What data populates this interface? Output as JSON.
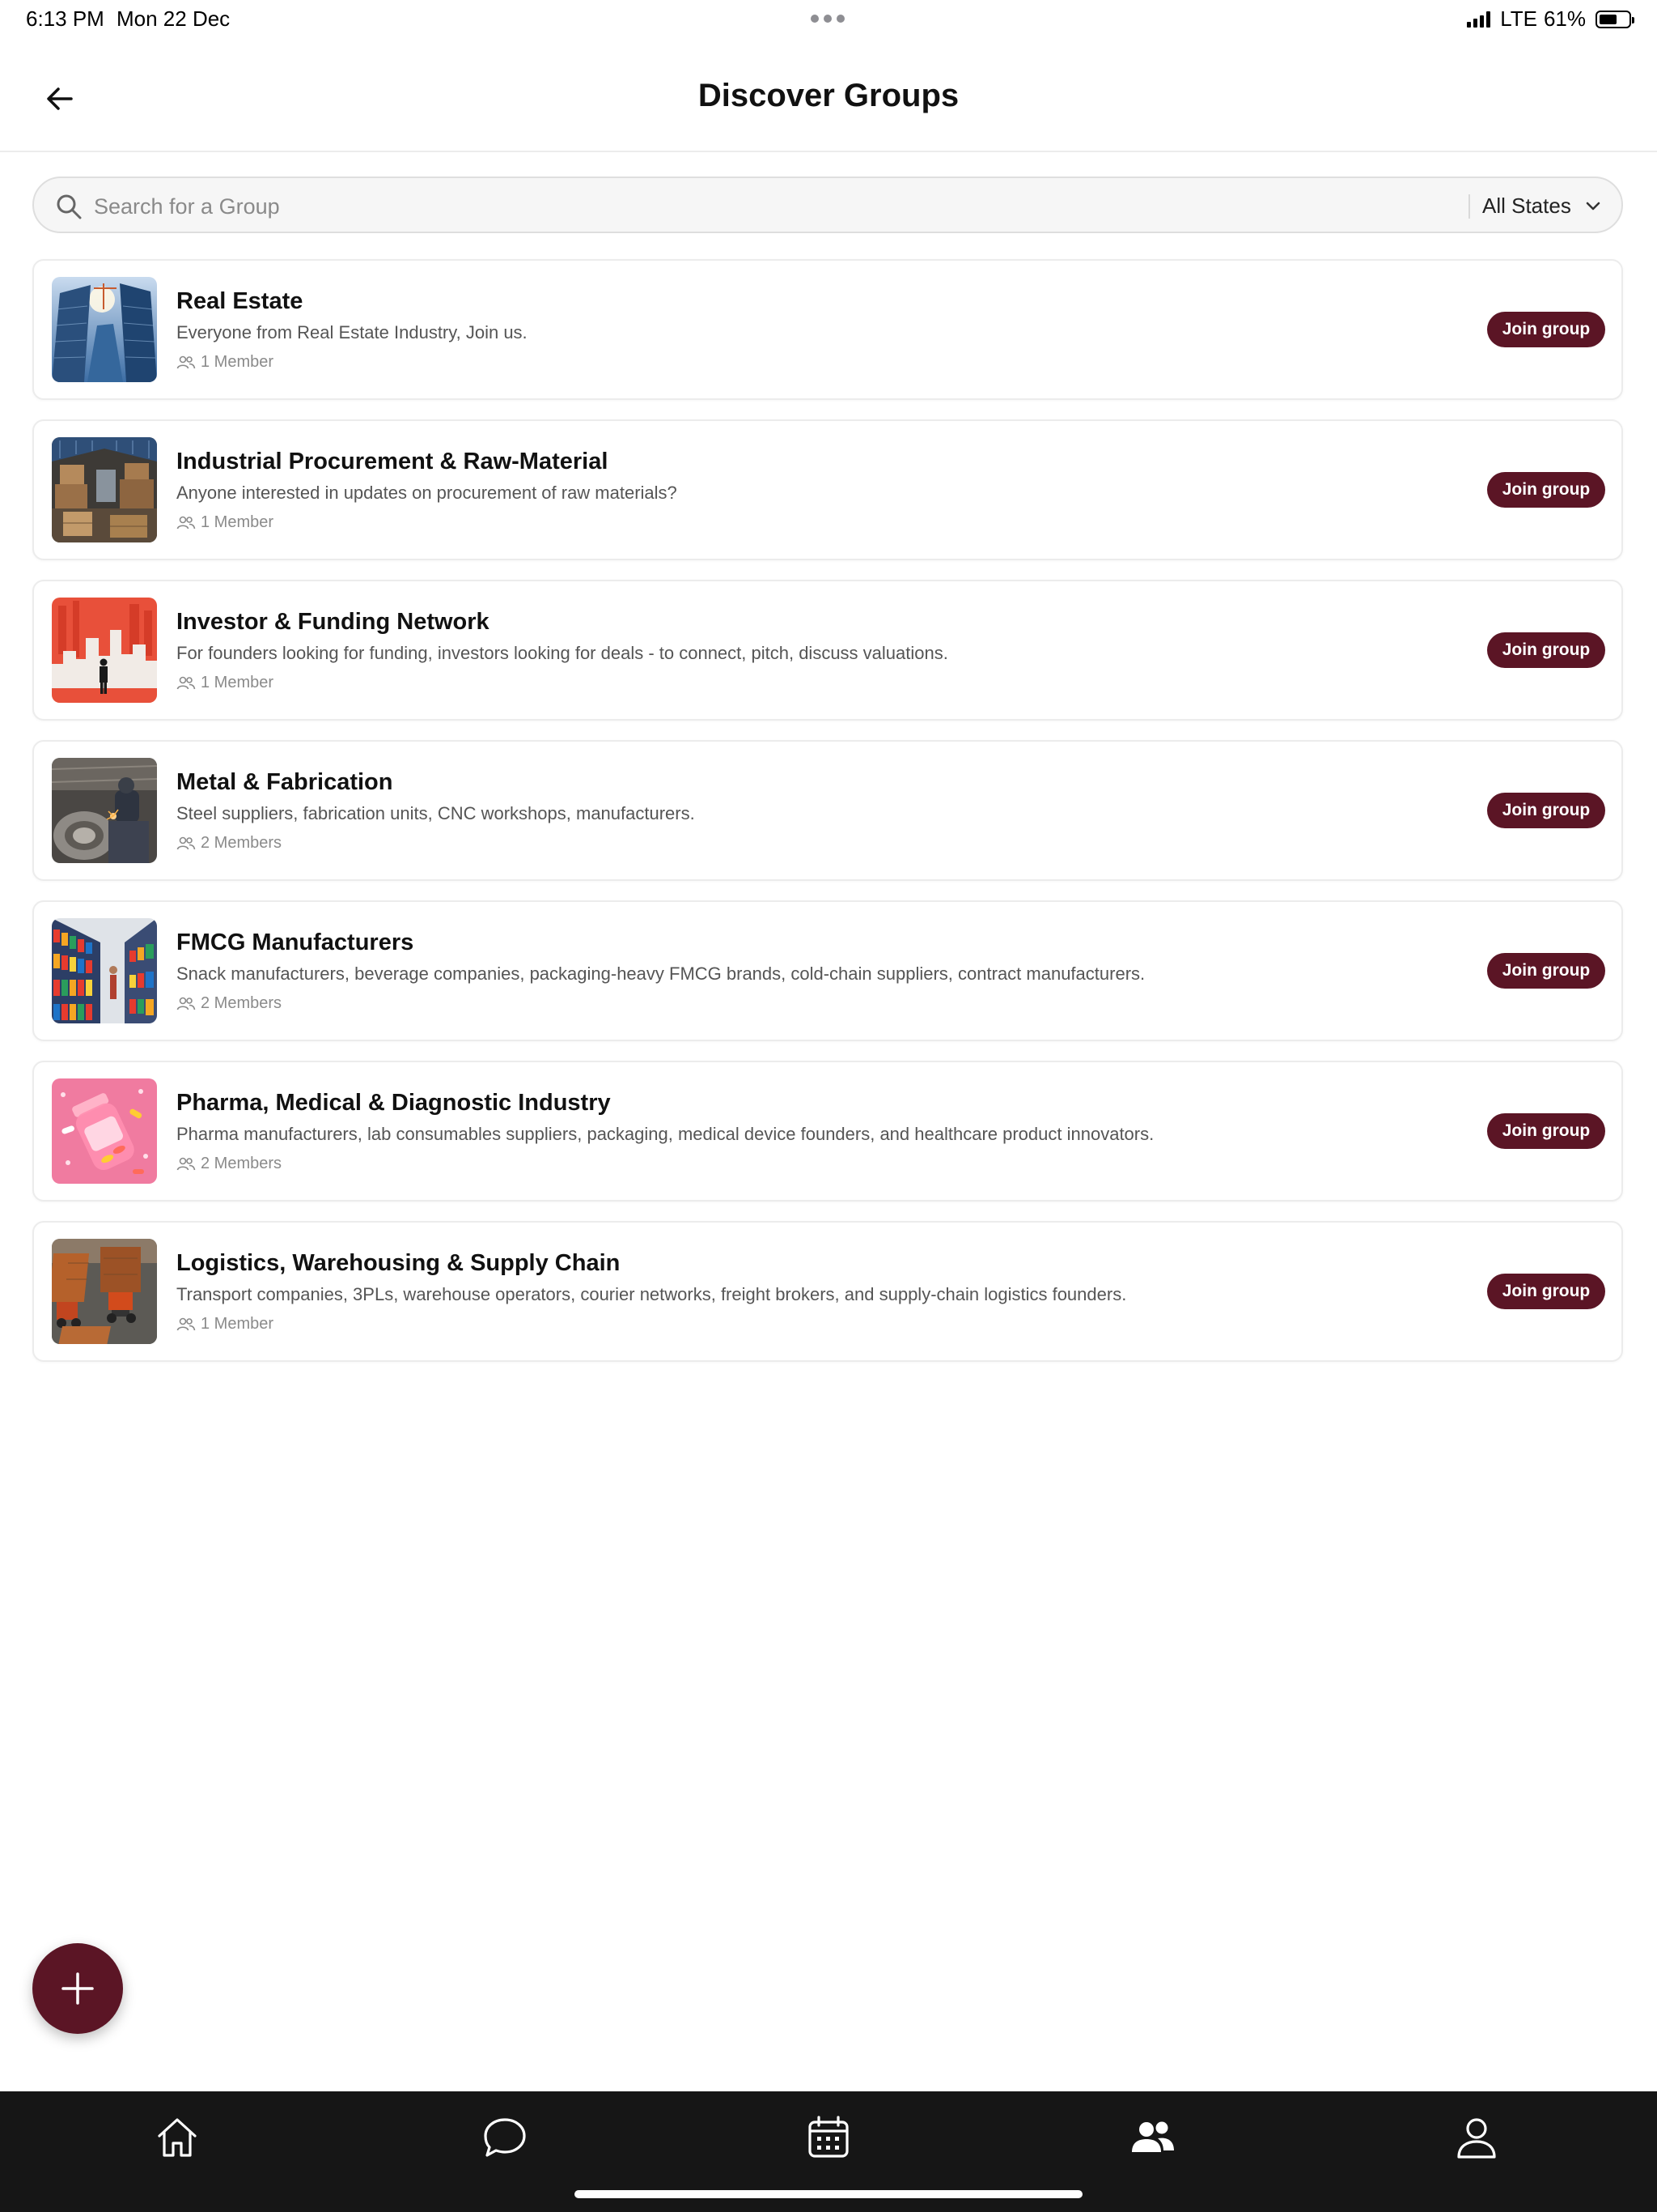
{
  "status_bar": {
    "time": "6:13 PM",
    "date": "Mon 22 Dec",
    "network": "LTE",
    "battery": "61%",
    "battery_level": 0.61
  },
  "header": {
    "title": "Discover Groups",
    "back_icon": "arrow-left-icon"
  },
  "search": {
    "placeholder": "Search for a Group",
    "value": "",
    "filter_label": "All States"
  },
  "groups": [
    {
      "name": "Real Estate",
      "description": "Everyone from Real Estate Industry, Join us.",
      "members": "1 Member",
      "button": "Join group",
      "thumb": "skyscraper-image"
    },
    {
      "name": "Industrial Procurement & Raw-Material",
      "description": "Anyone interested in updates on procurement of raw materials?",
      "members": "1 Member",
      "button": "Join group",
      "thumb": "warehouse-image"
    },
    {
      "name": "Investor & Funding Network",
      "description": "For founders looking for funding, investors looking for deals - to connect, pitch, discuss valuations.",
      "members": "1 Member",
      "button": "Join group",
      "thumb": "city-silhouette-image"
    },
    {
      "name": "Metal & Fabrication",
      "description": "Steel suppliers, fabrication units, CNC workshops, manufacturers.",
      "members": "2 Members",
      "button": "Join group",
      "thumb": "metal-workshop-image"
    },
    {
      "name": "FMCG Manufacturers",
      "description": "Snack manufacturers, beverage companies, packaging-heavy FMCG brands, cold-chain suppliers, contract manufacturers.",
      "members": "2 Members",
      "button": "Join group",
      "thumb": "store-shelves-image"
    },
    {
      "name": "Pharma, Medical & Diagnostic Industry",
      "description": "Pharma manufacturers, lab consumables suppliers, packaging, medical device founders, and healthcare product innovators.",
      "members": "2 Members",
      "button": "Join group",
      "thumb": "pill-bottle-image"
    },
    {
      "name": "Logistics, Warehousing & Supply Chain",
      "description": "Transport companies, 3PLs, warehouse operators, courier networks, freight brokers, and supply-chain logistics founders.",
      "members": "1 Member",
      "button": "Join group",
      "thumb": "trucks-image"
    }
  ],
  "fab": {
    "icon": "plus-icon"
  },
  "tab_bar": {
    "items": [
      {
        "icon": "home-icon"
      },
      {
        "icon": "chat-icon"
      },
      {
        "icon": "calendar-icon"
      },
      {
        "icon": "groups-icon",
        "active": true
      },
      {
        "icon": "profile-icon"
      }
    ]
  },
  "colors": {
    "accent": "#5b1525",
    "tab_bar_bg": "#161616",
    "muted_text": "#8a8a8a"
  }
}
